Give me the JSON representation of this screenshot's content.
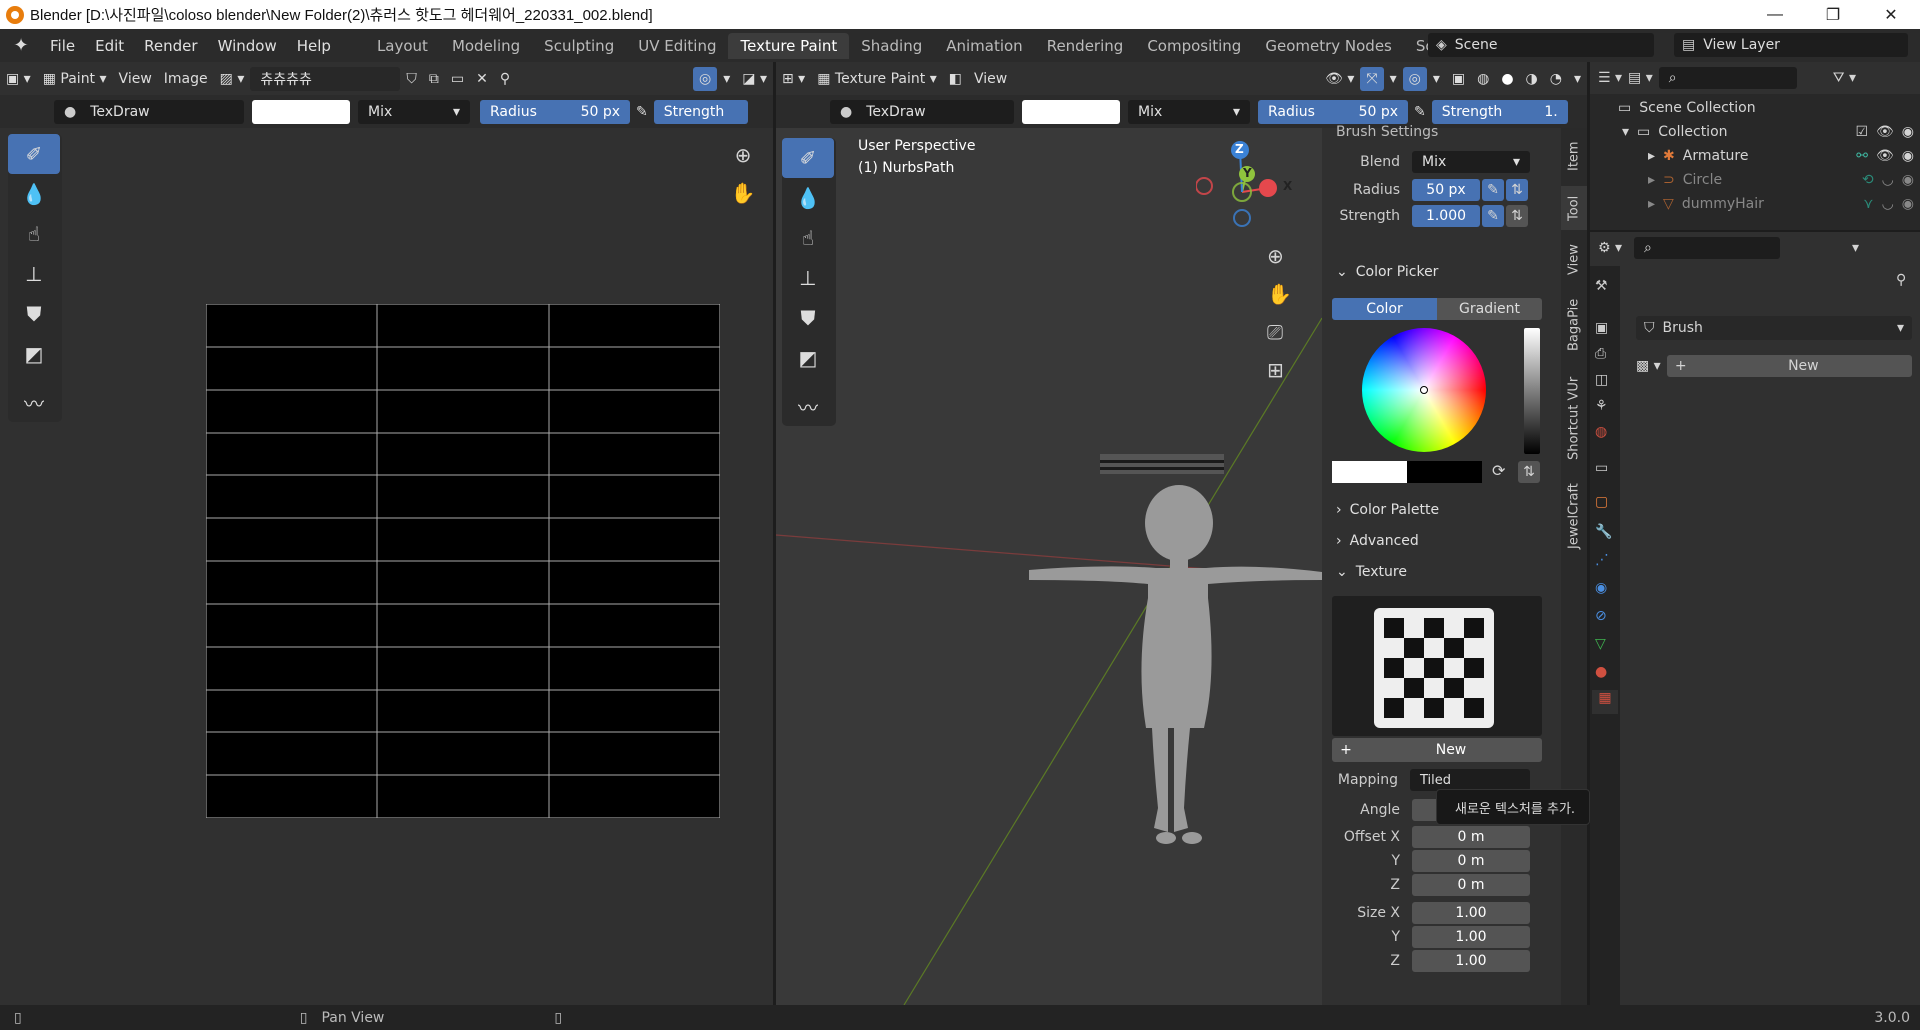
{
  "window": {
    "title": "Blender [D:\\사진파일\\coloso blender\\New Folder(2)\\츄러스 핫도그 헤더웨어_220331_002.blend]",
    "minimize": "—",
    "maximize": "❐",
    "close": "✕"
  },
  "menus": [
    "File",
    "Edit",
    "Render",
    "Window",
    "Help"
  ],
  "workspaces": [
    "Layout",
    "Modeling",
    "Sculpting",
    "UV Editing",
    "Texture Paint",
    "Shading",
    "Animation",
    "Rendering",
    "Compositing",
    "Geometry Nodes",
    "Scripting"
  ],
  "workspace_add": "+",
  "scene": {
    "label": "Scene",
    "view_layer": "View Layer"
  },
  "image_editor": {
    "mode": "Paint",
    "menus": [
      "View",
      "Image"
    ],
    "image_name": "츄츄츄츄",
    "brush": "TexDraw",
    "blend": "Mix",
    "radius_label": "Radius",
    "radius_value": "50 px",
    "strength_label": "Strength"
  },
  "viewport": {
    "mode": "Texture Paint",
    "menu": "View",
    "perspective": "User Perspective",
    "object": "(1) NurbsPath",
    "brush": "TexDraw",
    "blend": "Mix",
    "radius_label": "Radius",
    "radius_value": "50 px",
    "strength_label": "Strength",
    "strength_partial": "1."
  },
  "gizmo": {
    "x": "X",
    "y": "Y",
    "z": "Z"
  },
  "npanel": {
    "brush_settings": "Brush Settings",
    "blend_label": "Blend",
    "blend_value": "Mix",
    "radius_label": "Radius",
    "radius_value": "50 px",
    "strength_label": "Strength",
    "strength_value": "1.000",
    "color_picker": "Color Picker",
    "color_tab": "Color",
    "gradient_tab": "Gradient",
    "color_palette": "Color Palette",
    "advanced": "Advanced",
    "texture": "Texture",
    "new_button": "New",
    "mapping_label": "Mapping",
    "mapping_value": "Tiled",
    "angle_label": "Angle",
    "offset_x_label": "Offset X",
    "offset_y_label": "Y",
    "offset_z_label": "Z",
    "offset_x": "0 m",
    "offset_y": "0 m",
    "offset_z": "0 m",
    "size_x_label": "Size X",
    "size_y_label": "Y",
    "size_z_label": "Z",
    "size_x": "1.00",
    "size_y": "1.00",
    "size_z": "1.00",
    "tabs": [
      "Item",
      "Tool",
      "View",
      "BagaPie",
      "Shortcut VUr",
      "JewelCraft"
    ]
  },
  "tooltip": "새로운 텍스처를 추가.",
  "outliner": {
    "root": "Scene Collection",
    "collection": "Collection",
    "items": [
      {
        "name": "Armature"
      },
      {
        "name": "Circle"
      },
      {
        "name": "dummyHair"
      }
    ]
  },
  "properties": {
    "brush_label": "Brush",
    "new_button": "New"
  },
  "statusbar": {
    "pan": "Pan View",
    "version": "3.0.0"
  },
  "colors": {
    "accent": "#4772b3",
    "xaxis": "#e5484d",
    "yaxis": "#8fc33d",
    "zaxis": "#3b82d6"
  }
}
